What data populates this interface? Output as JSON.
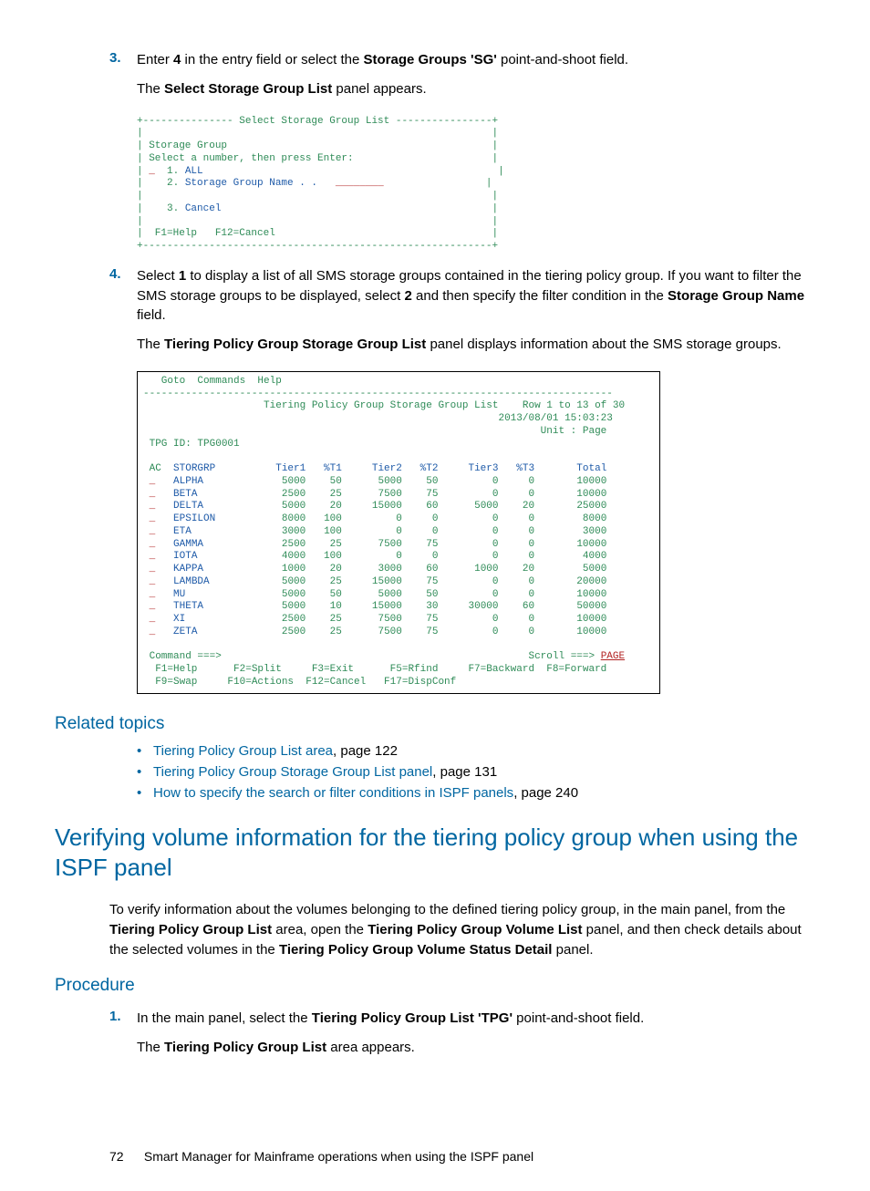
{
  "step3": {
    "num": "3.",
    "line1_a": "Enter ",
    "line1_b": "4",
    "line1_c": " in the entry field or select the ",
    "line1_d": "Storage Groups 'SG'",
    "line1_e": " point-and-shoot field.",
    "line2_a": "The ",
    "line2_b": "Select Storage Group List",
    "line2_c": " panel appears."
  },
  "panel1": {
    "top": "+--------------- Select Storage Group List ----------------+",
    "r1": "|                                                          |",
    "r2": "| Storage Group                                            |",
    "r3": "| Select a number, then press Enter:                       |",
    "r4a": "| ",
    "r4b": "_",
    "r4c": "  1. ",
    "r4d": "ALL",
    "r4e": "                                                 |",
    "r5a": "|    2. ",
    "r5b": "Storage Group Name . .",
    "r5c": "   ",
    "r5d": "________",
    "r5e": "                 |",
    "r6": "|                                                          |",
    "r7a": "|    3. ",
    "r7b": "Cancel",
    "r7c": "                                             |",
    "r8": "|                                                          |",
    "r9": "|  F1=Help   F12=Cancel                                    |",
    "bot": "+----------------------------------------------------------+"
  },
  "step4": {
    "num": "4.",
    "p1_a": "Select ",
    "p1_b": "1",
    "p1_c": " to display a list of all SMS storage groups contained in the tiering policy group. If you want to filter the SMS storage groups to be displayed, select ",
    "p1_d": "2",
    "p1_e": " and then specify the filter condition in the ",
    "p1_f": "Storage Group Name",
    "p1_g": " field.",
    "p2_a": "The ",
    "p2_b": "Tiering Policy Group Storage Group List",
    "p2_c": " panel displays information about the SMS storage groups."
  },
  "panel2": {
    "menu": "   Goto  Commands  Help                                                       ",
    "sep": "------------------------------------------------------------------------------",
    "title": "                    Tiering Policy Group Storage Group List    Row 1 to 13 of 30",
    "date": "                                                           2013/08/01 15:03:23",
    "unit": "                                                                  Unit : Page ",
    "tpg": " TPG ID: TPG0001                                                              ",
    "hdr": " AC  STORGRP          Tier1   %T1     Tier2   %T2     Tier3   %T3       Total",
    "rows": [
      " _   ALPHA             5000    50      5000    50         0     0       10000",
      " _   BETA              2500    25      7500    75         0     0       10000",
      " _   DELTA             5000    20     15000    60      5000    20       25000",
      " _   EPSILON           8000   100         0     0         0     0        8000",
      " _   ETA               3000   100         0     0         0     0        3000",
      " _   GAMMA             2500    25      7500    75         0     0       10000",
      " _   IOTA              4000   100         0     0         0     0        4000",
      " _   KAPPA             1000    20      3000    60      1000    20        5000",
      " _   LAMBDA            5000    25     15000    75         0     0       20000",
      " _   MU                5000    50      5000    50         0     0       10000",
      " _   THETA             5000    10     15000    30     30000    60       50000",
      " _   XI                2500    25      7500    75         0     0       10000",
      " _   ZETA              2500    25      7500    75         0     0       10000"
    ],
    "cmd_a": " Command ===>",
    "cmd_b": "                                                   Scroll ===> ",
    "cmd_c": "PAGE",
    "fk1": "  F1=Help      F2=Split     F3=Exit      F5=Rfind     F7=Backward  F8=Forward",
    "fk2": "  F9=Swap     F10=Actions  F12=Cancel   F17=DispConf                         "
  },
  "related": {
    "heading": "Related topics",
    "items": [
      {
        "text": "Tiering Policy Group List area",
        "page": ", page 122"
      },
      {
        "text": "Tiering Policy Group Storage Group List panel",
        "page": ", page 131"
      },
      {
        "text": "How to specify the search or filter conditions in ISPF panels",
        "page": ", page 240"
      }
    ]
  },
  "h1": "Verifying volume information for the tiering policy group when using the ISPF panel",
  "intro_a": "To verify information about the volumes belonging to the defined tiering policy group, in the main panel, from the ",
  "intro_b": "Tiering Policy Group List",
  "intro_c": " area, open the ",
  "intro_d": "Tiering Policy Group Volume List",
  "intro_e": " panel, and then check details about the selected volumes in the ",
  "intro_f": "Tiering Policy Group Volume Status Detail",
  "intro_g": " panel.",
  "procedure": {
    "heading": "Procedure",
    "num": "1.",
    "p1_a": "In the main panel, select the ",
    "p1_b": "Tiering Policy Group List 'TPG'",
    "p1_c": " point-and-shoot field.",
    "p2_a": "The ",
    "p2_b": "Tiering Policy Group List",
    "p2_c": " area appears."
  },
  "footer": {
    "page": "72",
    "text": "Smart Manager for Mainframe operations when using the ISPF panel"
  },
  "chart_data": {
    "type": "table",
    "title": "Tiering Policy Group Storage Group List",
    "tpg_id": "TPG0001",
    "timestamp": "2013/08/01 15:03:23",
    "unit": "Page",
    "row_range": "Row 1 to 13 of 30",
    "columns": [
      "AC",
      "STORGRP",
      "Tier1",
      "%T1",
      "Tier2",
      "%T2",
      "Tier3",
      "%T3",
      "Total"
    ],
    "rows": [
      [
        "_",
        "ALPHA",
        5000,
        50,
        5000,
        50,
        0,
        0,
        10000
      ],
      [
        "_",
        "BETA",
        2500,
        25,
        7500,
        75,
        0,
        0,
        10000
      ],
      [
        "_",
        "DELTA",
        5000,
        20,
        15000,
        60,
        5000,
        20,
        25000
      ],
      [
        "_",
        "EPSILON",
        8000,
        100,
        0,
        0,
        0,
        0,
        8000
      ],
      [
        "_",
        "ETA",
        3000,
        100,
        0,
        0,
        0,
        0,
        3000
      ],
      [
        "_",
        "GAMMA",
        2500,
        25,
        7500,
        75,
        0,
        0,
        10000
      ],
      [
        "_",
        "IOTA",
        4000,
        100,
        0,
        0,
        0,
        0,
        4000
      ],
      [
        "_",
        "KAPPA",
        1000,
        20,
        3000,
        60,
        1000,
        20,
        5000
      ],
      [
        "_",
        "LAMBDA",
        5000,
        25,
        15000,
        75,
        0,
        0,
        20000
      ],
      [
        "_",
        "MU",
        5000,
        50,
        5000,
        50,
        0,
        0,
        10000
      ],
      [
        "_",
        "THETA",
        5000,
        10,
        15000,
        30,
        30000,
        60,
        50000
      ],
      [
        "_",
        "XI",
        2500,
        25,
        7500,
        75,
        0,
        0,
        10000
      ],
      [
        "_",
        "ZETA",
        2500,
        25,
        7500,
        75,
        0,
        0,
        10000
      ]
    ]
  }
}
